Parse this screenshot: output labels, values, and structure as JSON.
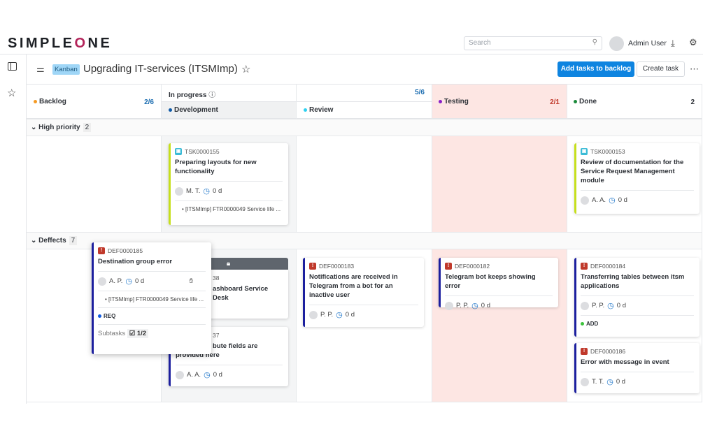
{
  "header": {
    "logo": "SIMPLEONE",
    "search_placeholder": "Search",
    "user": "Admin User"
  },
  "toolbar": {
    "badge": "Kanban",
    "title": "Upgrading IT-services (ITSMImp)",
    "add_tasks": "Add tasks to backlog",
    "create_task": "Create task"
  },
  "columns": {
    "backlog": {
      "label": "Backlog",
      "count": "2/6",
      "color": "#f59a23"
    },
    "in_progress": {
      "label": "In progress",
      "count": "5/6"
    },
    "development": {
      "label": "Development",
      "color": "#0f5aa8"
    },
    "review": {
      "label": "Review",
      "color": "#2fd0f0"
    },
    "testing": {
      "label": "Testing",
      "count": "2/1",
      "color": "#8a1fc7"
    },
    "done": {
      "label": "Done",
      "count": "2",
      "color": "#1a8a3a"
    }
  },
  "groups": [
    {
      "label": "High priority",
      "count": "2"
    },
    {
      "label": "Deffects",
      "count": "7"
    }
  ],
  "cards": {
    "c155": {
      "id": "TSK0000155",
      "title": "Preparing layouts for new functionality",
      "assignee": "M. T.",
      "time": "0 d",
      "link": "[ITSMImp] FTR0000049 Service life ..."
    },
    "c153": {
      "id": "TSK0000153",
      "title": "Review of documentation for the Service Request Management module",
      "assignee": "A. A.",
      "time": "0 d"
    },
    "c185": {
      "id": "DEF0000185",
      "title": "Destination group error",
      "assignee": "A. P.",
      "time": "0 d",
      "link": "[ITSMImp] FTR0000049 Service life ...",
      "tag": "REQ",
      "subtasks_label": "Subtasks",
      "subtasks": "1/2"
    },
    "hiddenA": {
      "id": "38",
      "title": "ashboard Service Desk"
    },
    "hiddenB": {
      "id": "37",
      "title1": "bute fields are",
      "title2": "provided here",
      "assignee": "A. A.",
      "time": "0 d"
    },
    "c183": {
      "id": "DEF0000183",
      "title": "Notifications are received in Telegram from a bot for an inactive user",
      "assignee": "P. P.",
      "time": "0 d"
    },
    "c182": {
      "id": "DEF0000182",
      "title": "Telegram bot keeps showing error",
      "assignee": "P. P.",
      "time": "0 d"
    },
    "c184": {
      "id": "DEF0000184",
      "title": "Transferring tables between itsm applications",
      "assignee": "P. P.",
      "time": "0 d",
      "tag": "ADD"
    },
    "c186": {
      "id": "DEF0000186",
      "title": "Error with message in event",
      "assignee": "T. T.",
      "time": "0 d"
    }
  }
}
